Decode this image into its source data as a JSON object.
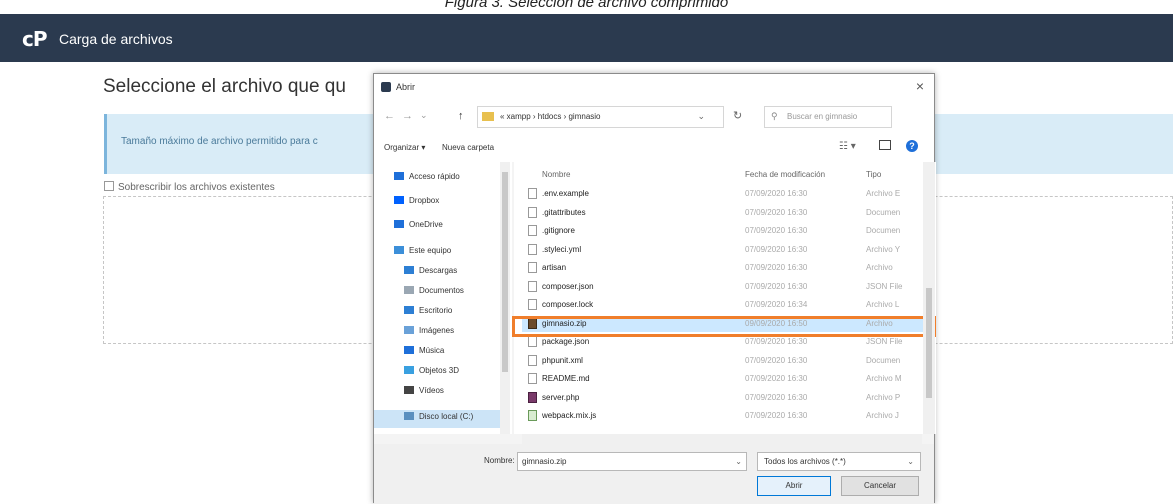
{
  "figure_caption": "Figura 3. Selección de archivo comprimido",
  "app": {
    "logo": "cP",
    "title": "Carga de archivos"
  },
  "page": {
    "heading": "Seleccione el archivo que qu",
    "info_text": "Tamaño máximo de archivo permitido para c",
    "overwrite_label": "Sobrescribir los archivos existentes"
  },
  "dialog": {
    "title": "Abrir",
    "close": "×",
    "nav": {
      "back": "←",
      "forward": "→",
      "recent": "⌄",
      "up": "↑"
    },
    "address_parts": [
      "«",
      "xampp",
      ">",
      "htdocs",
      ">",
      "gimnasio"
    ],
    "address_text": "«  xampp  ›  htdocs  ›  gimnasio",
    "refresh": "↻",
    "search_placeholder": "Buscar en gimnasio",
    "toolbar": {
      "organize": "Organizar ▾",
      "new_folder": "Nueva carpeta",
      "help": "?"
    },
    "nav_items": [
      {
        "label": "Acceso rápido",
        "color": "#1e6fd9"
      },
      {
        "label": "Dropbox",
        "color": "#0061fe"
      },
      {
        "label": "OneDrive",
        "color": "#1e6fd9"
      },
      {
        "label": "Este equipo",
        "color": "#3c8fd9"
      },
      {
        "label": "Descargas",
        "color": "#2d7fd4"
      },
      {
        "label": "Documentos",
        "color": "#9aa7b3"
      },
      {
        "label": "Escritorio",
        "color": "#2d7fd4"
      },
      {
        "label": "Imágenes",
        "color": "#6aa1d8"
      },
      {
        "label": "Música",
        "color": "#1e6fd9"
      },
      {
        "label": "Objetos 3D",
        "color": "#3aa0e0"
      },
      {
        "label": "Vídeos",
        "color": "#444444"
      },
      {
        "label": "Disco local (C:)",
        "color": "#5a8fbf"
      }
    ],
    "columns": {
      "name": "Nombre",
      "date": "Fecha de modificación",
      "type": "Tipo"
    },
    "files": [
      {
        "name": ".env.example",
        "date": "07/09/2020 16:30",
        "type": "Archivo E",
        "selected": false,
        "icon": "file-icon"
      },
      {
        "name": ".gitattributes",
        "date": "07/09/2020 16:30",
        "type": "Documen",
        "selected": false,
        "icon": "file-icon"
      },
      {
        "name": ".gitignore",
        "date": "07/09/2020 16:30",
        "type": "Documen",
        "selected": false,
        "icon": "file-icon"
      },
      {
        "name": ".styleci.yml",
        "date": "07/09/2020 16:30",
        "type": "Archivo Y",
        "selected": false,
        "icon": "file-icon"
      },
      {
        "name": "artisan",
        "date": "07/09/2020 16:30",
        "type": "Archivo",
        "selected": false,
        "icon": "file-icon"
      },
      {
        "name": "composer.json",
        "date": "07/09/2020 16:30",
        "type": "JSON File",
        "selected": false,
        "icon": "file-icon"
      },
      {
        "name": "composer.lock",
        "date": "07/09/2020 16:34",
        "type": "Archivo L",
        "selected": false,
        "icon": "file-icon"
      },
      {
        "name": "gimnasio.zip",
        "date": "09/09/2020 16:50",
        "type": "Archivo",
        "selected": true,
        "icon": "zip-icon"
      },
      {
        "name": "package.json",
        "date": "07/09/2020 16:30",
        "type": "JSON File",
        "selected": false,
        "icon": "file-icon"
      },
      {
        "name": "phpunit.xml",
        "date": "07/09/2020 16:30",
        "type": "Documen",
        "selected": false,
        "icon": "file-icon"
      },
      {
        "name": "README.md",
        "date": "07/09/2020 16:30",
        "type": "Archivo M",
        "selected": false,
        "icon": "file-icon"
      },
      {
        "name": "server.php",
        "date": "07/09/2020 16:30",
        "type": "Archivo P",
        "selected": false,
        "icon": "php-icon"
      },
      {
        "name": "webpack.mix.js",
        "date": "07/09/2020 16:30",
        "type": "Archivo J",
        "selected": false,
        "icon": "js-icon"
      }
    ],
    "filename_label": "Nombre:",
    "filename_value": "gimnasio.zip",
    "filetype_value": "Todos los archivos (*.*)",
    "open_button": "Abrir",
    "cancel_button": "Cancelar"
  }
}
